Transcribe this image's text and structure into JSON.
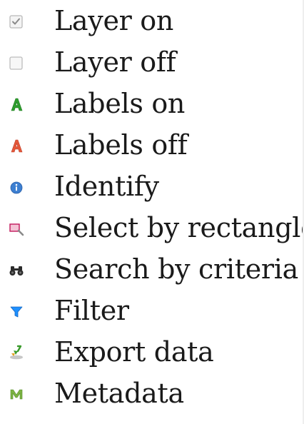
{
  "legend": {
    "items": [
      {
        "icon": "checkbox-checked-icon",
        "label": "Layer on"
      },
      {
        "icon": "checkbox-unchecked-icon",
        "label": "Layer off"
      },
      {
        "icon": "labels-on-icon",
        "label": "Labels on",
        "color": "#2e9e2e"
      },
      {
        "icon": "labels-off-icon",
        "label": "Labels off",
        "color": "#e4583a"
      },
      {
        "icon": "info-icon",
        "label": "Identify",
        "color": "#3d7fd1"
      },
      {
        "icon": "select-rectangle-icon",
        "label": "Select by rectangle",
        "color": "#c2185b"
      },
      {
        "icon": "binoculars-icon",
        "label": "Search by criteria"
      },
      {
        "icon": "filter-icon",
        "label": "Filter",
        "color": "#1e90ff"
      },
      {
        "icon": "export-icon",
        "label": "Export data",
        "color": "#3a9a2b"
      },
      {
        "icon": "metadata-icon",
        "label": "Metadata",
        "color": "#7cb342"
      }
    ]
  }
}
